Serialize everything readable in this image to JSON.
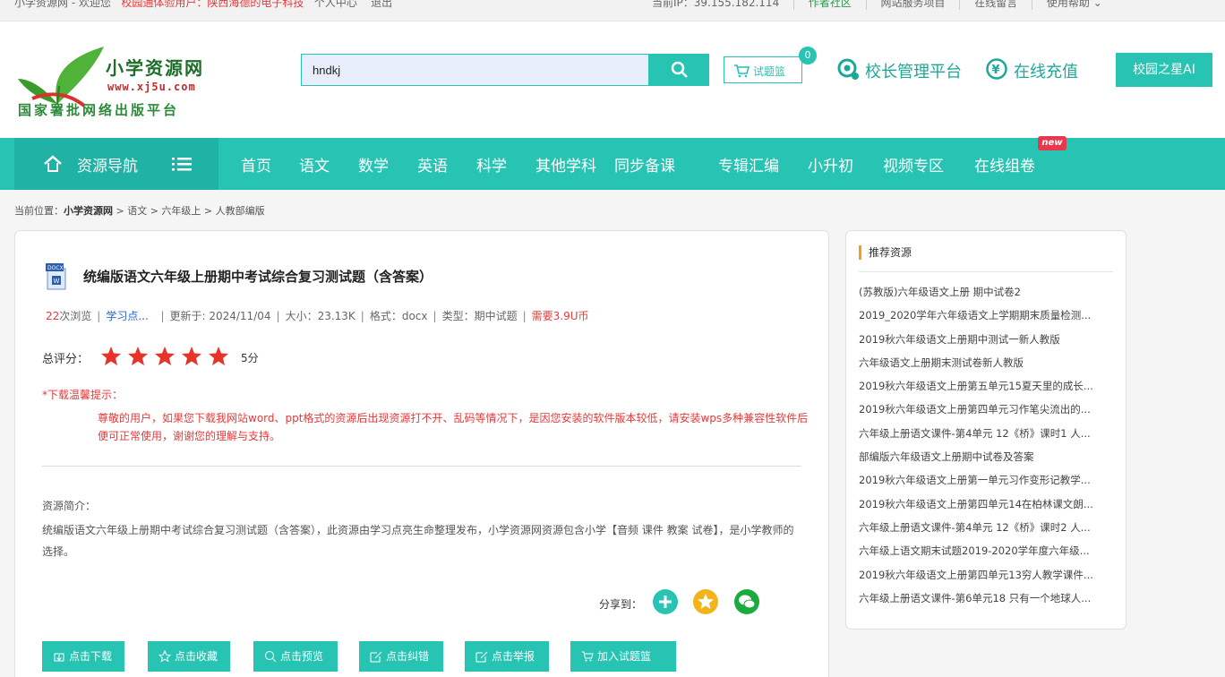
{
  "topbar": {
    "welcome": "小学资源网 - 欢迎您",
    "user": "校园通体验用户：陕西海德的电子科技",
    "personal": "个人中心",
    "logout": "退出",
    "ip": "当前IP：39.155.182.114",
    "links": [
      "作者社区",
      "网站服务项目",
      "在线留言",
      "使用帮助"
    ]
  },
  "logo": {
    "name": "小学资源网",
    "url": "www.xj5u.com",
    "slogan": "国家署批网络出版平台"
  },
  "search": {
    "value": "hndkj"
  },
  "basket": {
    "label": "试题篮",
    "count": "0"
  },
  "header_links": {
    "principal": "校长管理平台",
    "recharge": "在线充值",
    "ai": "校园之星AI"
  },
  "nav": {
    "home": "资源导航",
    "items": [
      "首页",
      "语文",
      "数学",
      "英语",
      "科学",
      "其他学科",
      "同步备课",
      "专辑汇编",
      "小升初",
      "视频专区",
      "在线组卷"
    ],
    "new_badge": "new"
  },
  "breadcrumb": {
    "prefix": "当前位置：",
    "site": "小学资源网",
    "path": " > 语文 > 六年级上 > 人教部编版"
  },
  "doc": {
    "file_type": "DOCX",
    "title": "统编版语文六年级上册期中考试综合复习测试题（含答案）",
    "views": "22",
    "views_suffix": "次浏览",
    "uploader": "学习点...",
    "updated": "更新于: 2024/11/04",
    "size": "大小：23.13K",
    "format": "格式：docx",
    "type": "类型：期中试题",
    "price": "需要3.9U币"
  },
  "rating": {
    "label": "总评分：",
    "score": "5分",
    "stars": 5
  },
  "tip": {
    "title": "*下载温馨提示：",
    "body": "尊敬的用户，如果您下载我网站word、ppt格式的资源后出现资源打不开、乱码等情况下，是因您安装的软件版本较低，请安装wps多种兼容性软件后便可正常使用，谢谢您的理解与支持。"
  },
  "intro": {
    "title": "资源简介：",
    "body": "统编版语文六年级上册期中考试综合复习测试题（含答案），此资源由学习点亮生命整理发布，小学资源网资源包含小学【音频 课件 教案 试卷】，是小学教师的选择。"
  },
  "share": {
    "label": "分享到："
  },
  "actions": [
    "点击下载",
    "点击收藏",
    "点击预览",
    "点击纠错",
    "点击举报",
    "加入试题篮"
  ],
  "sidebar": {
    "title": "推荐资源",
    "items": [
      "(苏教版)六年级语文上册 期中试卷2",
      "2019_2020学年六年级语文上学期期末质量检测...",
      "2019秋六年级语文上册期中测试一新人教版",
      "六年级语文上册期末测试卷新人教版",
      "2019秋六年级语文上册第五单元15夏天里的成长...",
      "2019秋六年级语文上册第四单元习作笔尖流出的...",
      "六年级上册语文课件-第4单元 12《桥》课时1 人...",
      "部编版六年级语文上册期中试卷及答案",
      "2019秋六年级语文上册第一单元习作变形记教学...",
      "2019秋六年级语文上册第四单元14在柏林课文朗...",
      "六年级上册语文课件-第4单元 12《桥》课时2 人...",
      "六年级上语文期末试题2019-2020学年度六年级...",
      "2019秋六年级语文上册第四单元13穷人教学课件...",
      "六年级上册语文课件-第6单元18 只有一个地球人..."
    ]
  }
}
